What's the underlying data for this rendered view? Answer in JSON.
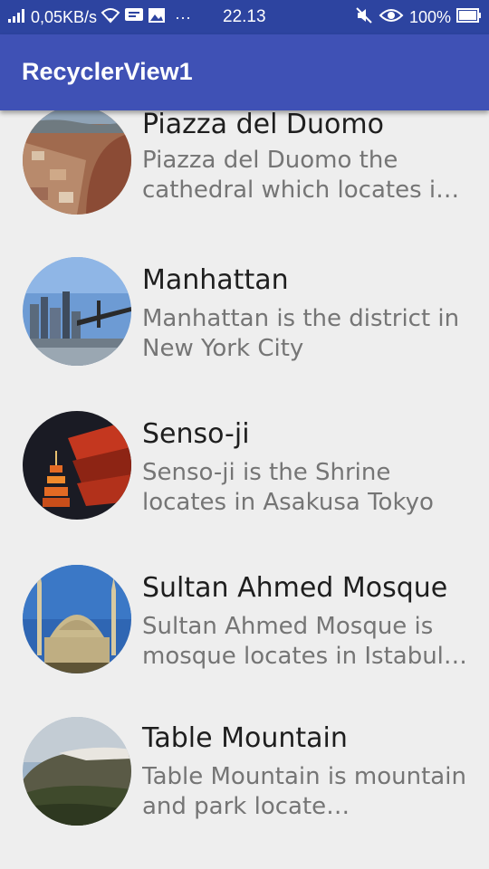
{
  "status_bar": {
    "network_speed": "0,05KB/s",
    "time": "22.13",
    "battery": "100%",
    "more_dots": "···"
  },
  "app_bar": {
    "title": "RecyclerView1"
  },
  "list": {
    "items": [
      {
        "title": "Piazza del Duomo",
        "description": "Piazza del Duomo the cathedral which locates i…"
      },
      {
        "title": "Manhattan",
        "description": "Manhattan is the district in New York City"
      },
      {
        "title": "Senso-ji",
        "description": "Senso-ji is the Shrine locates in Asakusa Tokyo"
      },
      {
        "title": "Sultan Ahmed Mosque",
        "description": "Sultan Ahmed Mosque is mosque locates in Istabul…"
      },
      {
        "title": "Table Mountain",
        "description": "Table Mountain is mountain and park locate…"
      }
    ]
  },
  "colors": {
    "status_bar": "#2d44a0",
    "app_bar": "#3f51b5",
    "background": "#eeeeee",
    "title_text": "#1e1e1e",
    "description_text": "#757575"
  },
  "icons": [
    "signal-icon",
    "wifi-icon",
    "chat-icon",
    "image-icon",
    "mute-icon",
    "eye-icon",
    "battery-icon"
  ]
}
